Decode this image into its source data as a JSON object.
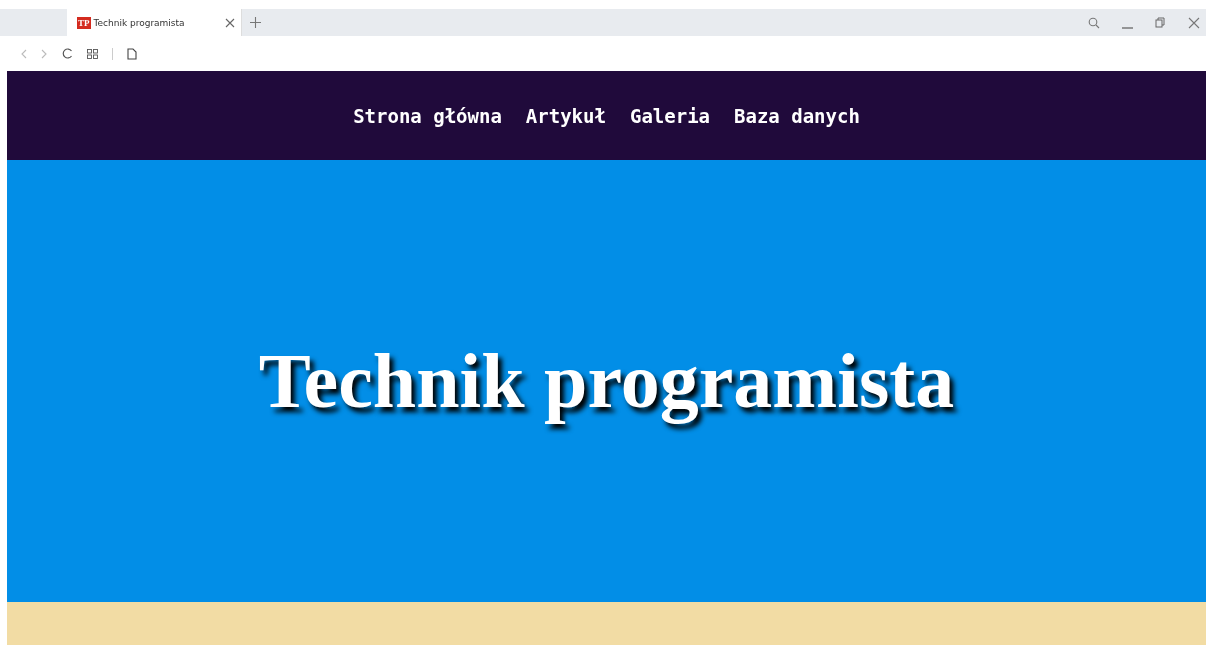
{
  "browser": {
    "tab": {
      "logo": "TP",
      "title": "Technik programista",
      "selected": true
    }
  },
  "nav": {
    "items": [
      {
        "label": "Strona główna"
      },
      {
        "label": "Artykuł"
      },
      {
        "label": "Galeria"
      },
      {
        "label": "Baza danych"
      }
    ]
  },
  "hero": {
    "title": "Technik programista"
  }
}
